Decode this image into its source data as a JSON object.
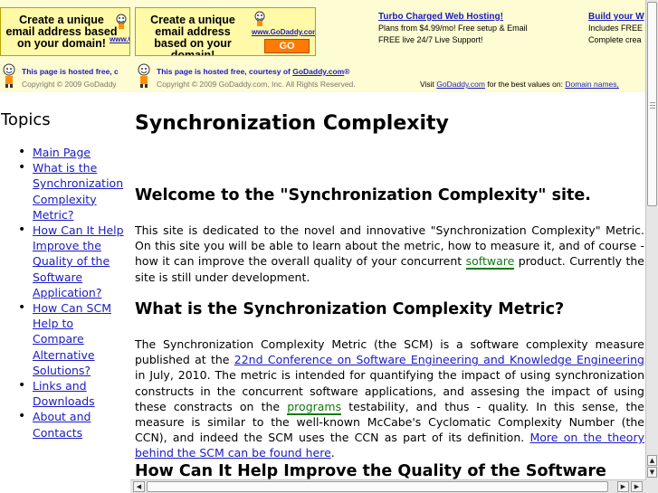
{
  "ads": {
    "banner": {
      "text": "Create a unique email address based on your domain!",
      "logo": "www.GoDaddy.com",
      "go_label": "GO"
    },
    "promo_1": {
      "title": "Turbo Charged Web Hosting!",
      "line1": "Plans from $4.99/mo! Free setup & Email",
      "line2": "FREE live 24/7 Live Support!"
    },
    "promo_2": {
      "title": "Build your W",
      "line1": "Includes FREE",
      "line2": "Complete crea"
    },
    "hosted": {
      "prefix": "This page is hosted free, courtesy of ",
      "link": "GoDaddy.com",
      "suffix": "®",
      "short": "This page is hosted free, c",
      "copyright": "Copyright © 2009 GoDaddy.com, Inc. All Rights Reserved.",
      "copyright_short": "Copyright © 2009 GoDaddy",
      "visit_prefix": "Visit ",
      "visit_link": "GoDaddy.com",
      "visit_middle": " for the best values on: ",
      "visit_link2": "Domain names,"
    }
  },
  "sidebar": {
    "title": "Topics",
    "items": [
      "Main Page",
      "What is the Synchronization Complexity Metric?",
      "How Can It Help Improve the Quality of the Software Application?",
      "How Can SCM Help to Compare Alternative Solutions?",
      "Links and Downloads",
      "About and Contacts"
    ]
  },
  "main": {
    "page_title": "Synchronization Complexity",
    "welcome_heading": "Welcome to the \"Synchronization Complexity\" site.",
    "welcome_p": {
      "before": "This site is dedicated to the novel and innovative \"Synchronization Complexity\" Metric. On this site you will be able to learn about the metric, how to measure it, and of course - how it can improve the overall quality of your concurrent ",
      "link": "software",
      "after": " product. Currently the site is still under development."
    },
    "what_heading": "What is the Synchronization Complexity Metric?",
    "what_p": {
      "part1": "The Synchronization Complexity Metric (the SCM) is a software complexity measure published at the ",
      "conf_link": "22nd Conference on Software Engineering and Knowledge Engineering",
      "part2": " in July, 2010. The metric is intended for quantifying the impact of using synchronization constructs in the concurrent software applications, and assesing the impact of using these constracts on the ",
      "programs_link": "programs",
      "part3": " testability, and thus - quality. In this sense, the measure is similar to the well-known McCabe's Cyclomatic Complexity Number (the CCN), and indeed the SCM uses the CCN as part of its definition. ",
      "more_link": "More on the theory behind the SCM can be found here",
      "part4": "."
    },
    "how_heading": "How Can It Help Improve the Quality of the Software"
  },
  "scrollbars": {
    "up": "▲",
    "down": "▼",
    "left": "◀",
    "right": "▶"
  }
}
